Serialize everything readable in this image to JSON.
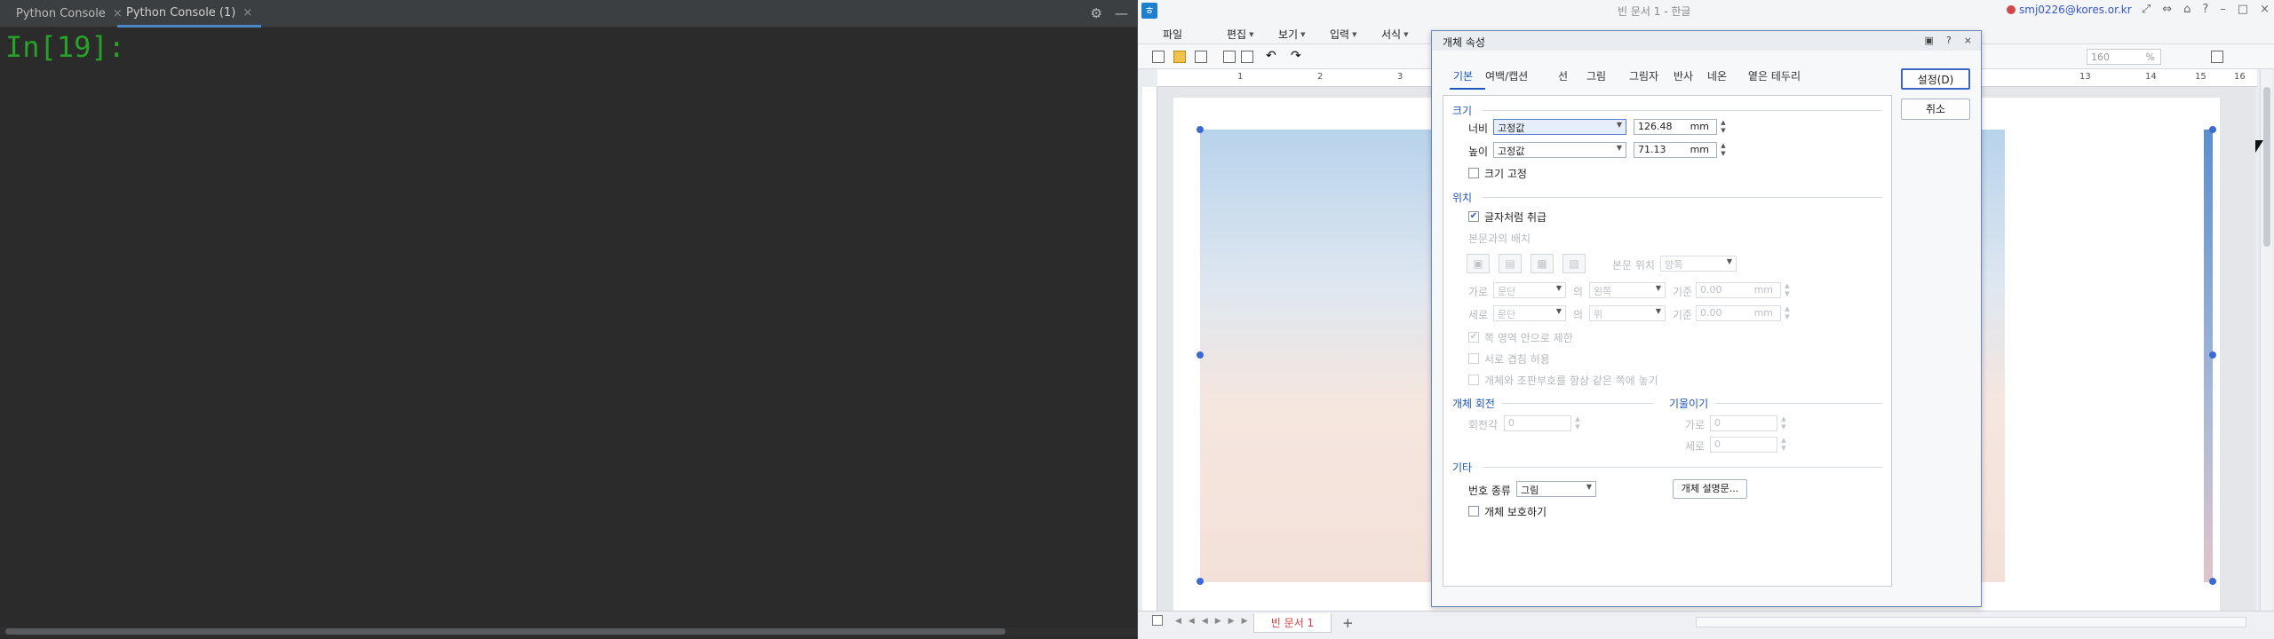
{
  "console": {
    "tabs": [
      {
        "label": "Python Console"
      },
      {
        "label": "Python Console (1)"
      }
    ],
    "prompt": "In[19]:"
  },
  "hwp": {
    "title": "빈 문서 1 - 한글",
    "user": "smj0226@kores.or.kr",
    "menu": [
      "파일",
      "편집",
      "보기",
      "입력",
      "서식"
    ],
    "zoom": "160",
    "zoom_unit": "%",
    "ruler_numbers": [
      "1",
      "2",
      "3",
      "13",
      "14",
      "15",
      "16"
    ],
    "page_tab": "빈 문서 1",
    "add_tab": "+"
  },
  "dialog": {
    "title": "개체 속성",
    "help": "?",
    "close": "×",
    "tabs": [
      "기본",
      "여백/캡션",
      "선",
      "그림",
      "그림자",
      "반사",
      "네온",
      "옅은 테두리"
    ],
    "ok_label": "설정(D)",
    "cancel_label": "취소",
    "size": {
      "title": "크기",
      "width_label": "너비",
      "width_mode": "고정값",
      "width_value": "126.48",
      "height_label": "높이",
      "height_mode": "고정값",
      "height_value": "71.13",
      "unit": "mm",
      "fix_label": "크기 고정"
    },
    "position": {
      "title": "위치",
      "treat_as_char": "글자처럼 취급",
      "wrap_label": "본문과의 배치",
      "body_pos_label": "본문 위치",
      "body_pos_value": "양쪽",
      "horiz_label": "가로",
      "horiz_ref": "문단",
      "horiz_of": "의",
      "horiz_dir": "왼쪽",
      "horiz_base": "기준",
      "horiz_value": "0.00",
      "vert_label": "세로",
      "vert_ref": "문단",
      "vert_of": "의",
      "vert_dir": "위",
      "vert_base": "기준",
      "vert_value": "0.00",
      "unit": "mm",
      "opt1": "쪽 영역 안으로 제한",
      "opt2": "서로 겹침 허용",
      "opt3": "개체와 조판부호를 항상 같은 쪽에 놓기"
    },
    "rotation": {
      "title": "개체 회전",
      "angle_label": "회전각",
      "angle_value": "0"
    },
    "skew": {
      "title": "기울이기",
      "h_label": "가로",
      "h_value": "0",
      "v_label": "세로",
      "v_value": "0"
    },
    "etc": {
      "title": "기타",
      "num_type_label": "번호 종류",
      "num_type_value": "그림",
      "desc_button": "개체 설명문...",
      "protect_label": "개체 보호하기"
    }
  }
}
